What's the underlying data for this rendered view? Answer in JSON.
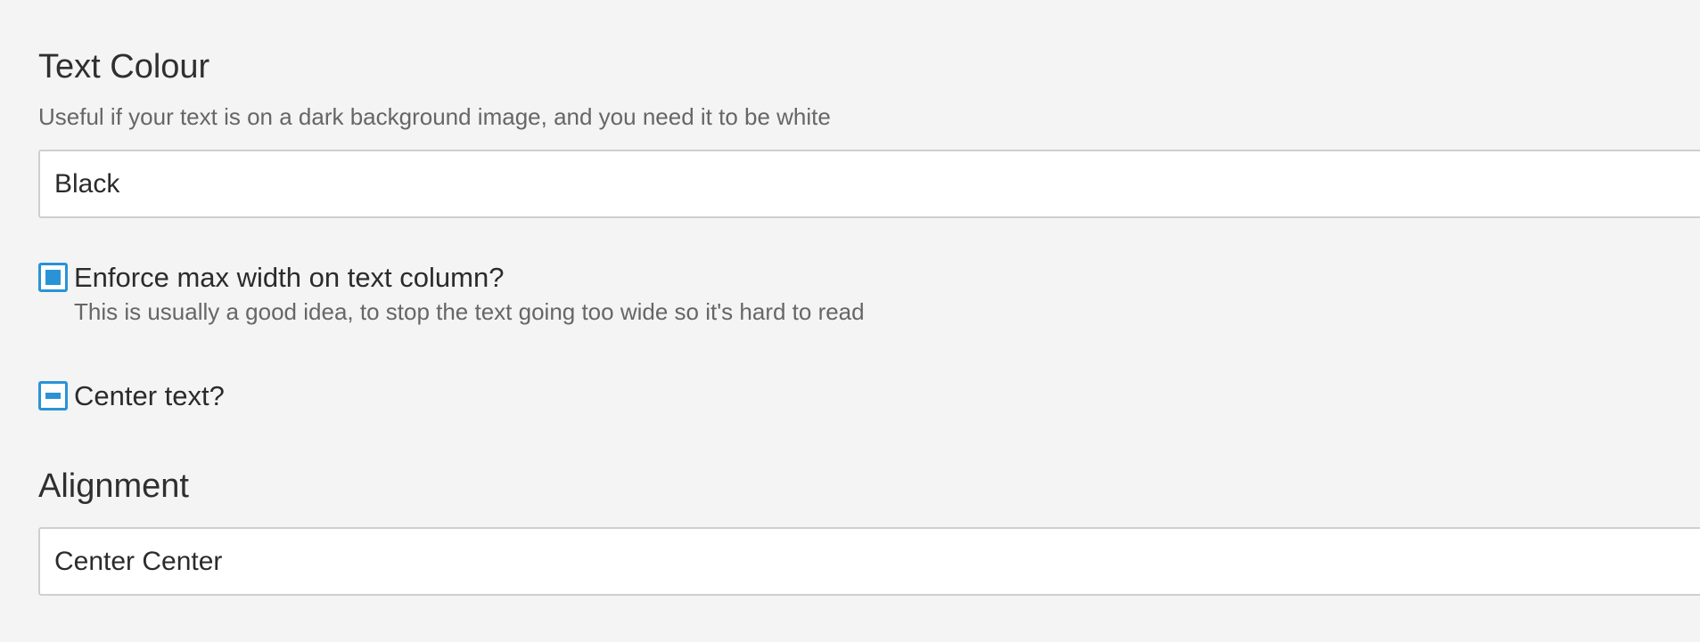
{
  "text_colour": {
    "title": "Text Colour",
    "help": "Useful if your text is on a dark background image, and you need it to be white",
    "value": "Black"
  },
  "max_width": {
    "label": "Enforce max width on text column?",
    "help": "This is usually a good idea, to stop the text going too wide so it's hard to read",
    "state": "checked"
  },
  "center_text": {
    "label": "Center text?",
    "state": "indeterminate"
  },
  "alignment": {
    "title": "Alignment",
    "value": "Center Center"
  },
  "colors": {
    "background": "#f4f4f4",
    "accent": "#2a93d5",
    "input_border": "#cfcfcf",
    "help_text": "#666666"
  }
}
